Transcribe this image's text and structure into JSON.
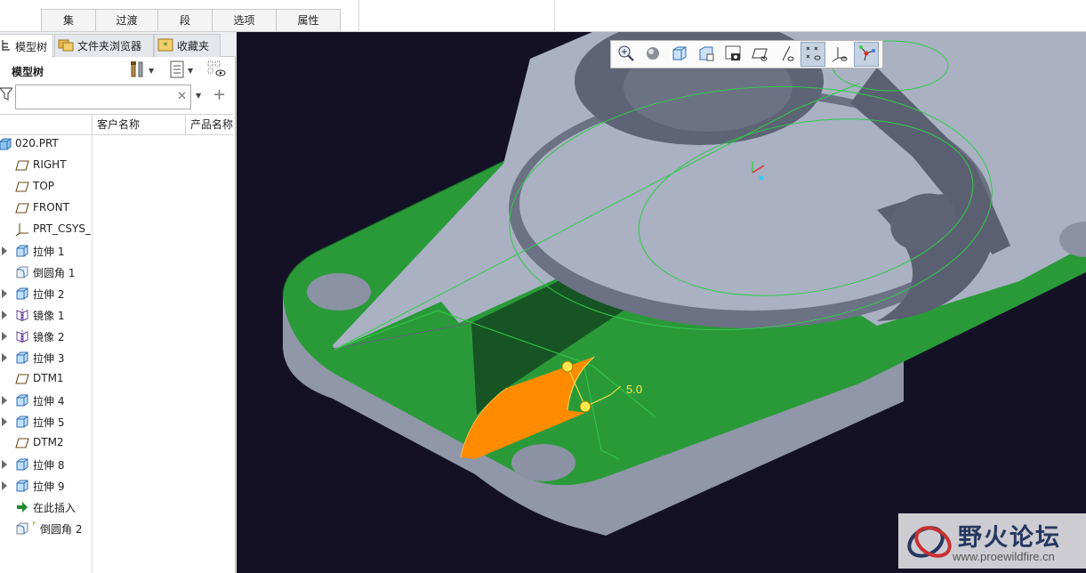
{
  "ribbon": {
    "tabs": [
      "集",
      "过渡",
      "段",
      "选项",
      "属性"
    ]
  },
  "nav": {
    "tabs": [
      {
        "label": "模型树",
        "icon": "model-tree-icon"
      },
      {
        "label": "文件夹浏览器",
        "icon": "folder-browser-icon"
      },
      {
        "label": "收藏夹",
        "icon": "favorites-icon"
      }
    ]
  },
  "tree": {
    "title": "模型树",
    "search": {
      "value": "",
      "placeholder": ""
    },
    "columns": [
      "客户名称",
      "产品名称"
    ],
    "items": [
      {
        "label": "020.PRT",
        "icon": "part-icon",
        "expandable": false,
        "root": true
      },
      {
        "label": "RIGHT",
        "icon": "datum-plane-icon",
        "expandable": false
      },
      {
        "label": "TOP",
        "icon": "datum-plane-icon",
        "expandable": false
      },
      {
        "label": "FRONT",
        "icon": "datum-plane-icon",
        "expandable": false
      },
      {
        "label": "PRT_CSYS_DEF",
        "icon": "csys-icon",
        "expandable": false
      },
      {
        "label": "拉伸 1",
        "icon": "extrude-icon",
        "expandable": true
      },
      {
        "label": "倒圆角 1",
        "icon": "round-icon",
        "expandable": false
      },
      {
        "label": "拉伸 2",
        "icon": "extrude-icon",
        "expandable": true
      },
      {
        "label": "镜像 1",
        "icon": "mirror-icon",
        "expandable": true
      },
      {
        "label": "镜像 2",
        "icon": "mirror-icon",
        "expandable": true
      },
      {
        "label": "拉伸 3",
        "icon": "extrude-icon",
        "expandable": true
      },
      {
        "label": "DTM1",
        "icon": "datum-plane-icon",
        "expandable": false
      },
      {
        "label": "拉伸 4",
        "icon": "extrude-icon",
        "expandable": true
      },
      {
        "label": "拉伸 5",
        "icon": "extrude-icon",
        "expandable": true
      },
      {
        "label": "DTM2",
        "icon": "datum-plane-icon",
        "expandable": false
      },
      {
        "label": "拉伸 8",
        "icon": "extrude-icon",
        "expandable": true
      },
      {
        "label": "拉伸 9",
        "icon": "extrude-icon",
        "expandable": true
      },
      {
        "label": "在此插入",
        "icon": "insert-here-icon",
        "expandable": false
      },
      {
        "label": "倒圆角 2",
        "icon": "round-new-icon",
        "expandable": false
      }
    ]
  },
  "viewport": {
    "toolbar_icons": [
      "zoom-in-icon",
      "display-style-icon",
      "saved-views-icon",
      "view-manager-icon",
      "perspective-icon",
      "plane-display-icon",
      "axis-display-icon",
      "point-display-icon",
      "csys-display-icon",
      "spin-center-icon"
    ],
    "active_icons": [
      "point-display-icon",
      "spin-center-icon"
    ],
    "dimension": "5.0",
    "colors": {
      "background": "#141126",
      "green_face": "#2a9a39",
      "metal": "#a9b1c3",
      "highlight": "#ff8c00",
      "dimension": "#ffe84d"
    }
  },
  "watermark": {
    "title": "野火论坛",
    "url": "www.proewildfire.cn"
  }
}
